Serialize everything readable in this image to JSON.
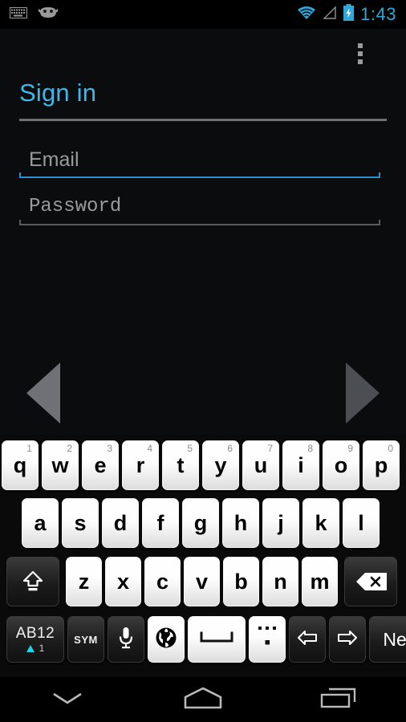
{
  "status_bar": {
    "icons_left": [
      "keyboard-icon",
      "android-face-icon"
    ],
    "icons_right": [
      "wifi-icon",
      "signal-icon",
      "battery-charging-icon"
    ],
    "clock": "1:43",
    "accent_color": "#2fa8d8"
  },
  "app": {
    "overflow_menu_label": "More options",
    "title": "Sign in",
    "title_color": "#3fb7e8"
  },
  "form": {
    "email": {
      "placeholder": "Email",
      "value": "",
      "focused": true
    },
    "password": {
      "placeholder": "Password",
      "value": "",
      "focused": false
    }
  },
  "pager": {
    "prev_label": "Previous",
    "next_label": "Next",
    "prev_color": "#6e7276",
    "next_color": "#4b4f53"
  },
  "keyboard": {
    "row1": [
      {
        "label": "q",
        "num": "1"
      },
      {
        "label": "w",
        "num": "2"
      },
      {
        "label": "e",
        "num": "3"
      },
      {
        "label": "r",
        "num": "4"
      },
      {
        "label": "t",
        "num": "5"
      },
      {
        "label": "y",
        "num": "6"
      },
      {
        "label": "u",
        "num": "7"
      },
      {
        "label": "i",
        "num": "8"
      },
      {
        "label": "o",
        "num": "9"
      },
      {
        "label": "p",
        "num": "0"
      }
    ],
    "row2": [
      {
        "label": "a"
      },
      {
        "label": "s"
      },
      {
        "label": "d"
      },
      {
        "label": "f"
      },
      {
        "label": "g"
      },
      {
        "label": "h"
      },
      {
        "label": "j"
      },
      {
        "label": "k"
      },
      {
        "label": "l"
      }
    ],
    "row3": {
      "shift": "shift-icon",
      "letters": [
        {
          "label": "z"
        },
        {
          "label": "x"
        },
        {
          "label": "c"
        },
        {
          "label": "v"
        },
        {
          "label": "b"
        },
        {
          "label": "n"
        },
        {
          "label": "m"
        }
      ],
      "backspace": "backspace-icon"
    },
    "row4": {
      "mode_main": "AB12",
      "mode_sub": "1",
      "mode_indicator_color": "#1fd3e3",
      "sym": "SYM",
      "mic": "microphone-icon",
      "language": "globe-icon",
      "space": "space-icon",
      "period": "period-icon",
      "arrow_left": "arrow-left-icon",
      "arrow_right": "arrow-right-icon",
      "enter": "Next"
    }
  },
  "navbar": {
    "back": "hide-keyboard-icon",
    "home": "home-icon",
    "recents": "recents-icon"
  }
}
